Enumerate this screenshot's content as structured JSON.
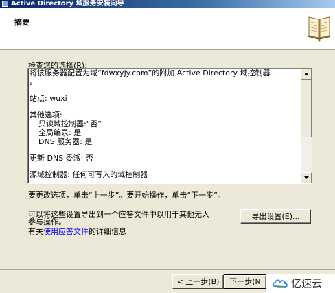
{
  "window": {
    "title": "Active Directory 域服务安装向导"
  },
  "header": {
    "heading": "摘要"
  },
  "summary": {
    "label": "检查您的选择(R):",
    "lines": [
      "将该服务器配置为域“fdwxyjy.com”的附加 Active Directory 域控制器",
      "。",
      "",
      "站点: wuxi",
      "",
      "其他选项:",
      "只读域控制器:“否”",
      "全局编录: 是",
      "DNS 服务器: 是",
      "",
      "更新 DNS 委派: 否",
      "",
      "源域控制器: 任何可写入的域控制器"
    ]
  },
  "hint": "要更改选项，单击“上一步”。要开始操作，单击“下一步”。",
  "export": {
    "text_line1": "可以将这些设置导出到一个应答文件中以用于其他无人",
    "text_line2": "参与操作。",
    "button_label": "导出设置(E)..."
  },
  "more_info": {
    "prefix": "有关",
    "link": "使用应答文件",
    "suffix": "的详细信息"
  },
  "nav": {
    "back_label": "< 上一步(B)",
    "next_label": "下一步(N"
  },
  "watermark": {
    "text": "亿速云"
  }
}
